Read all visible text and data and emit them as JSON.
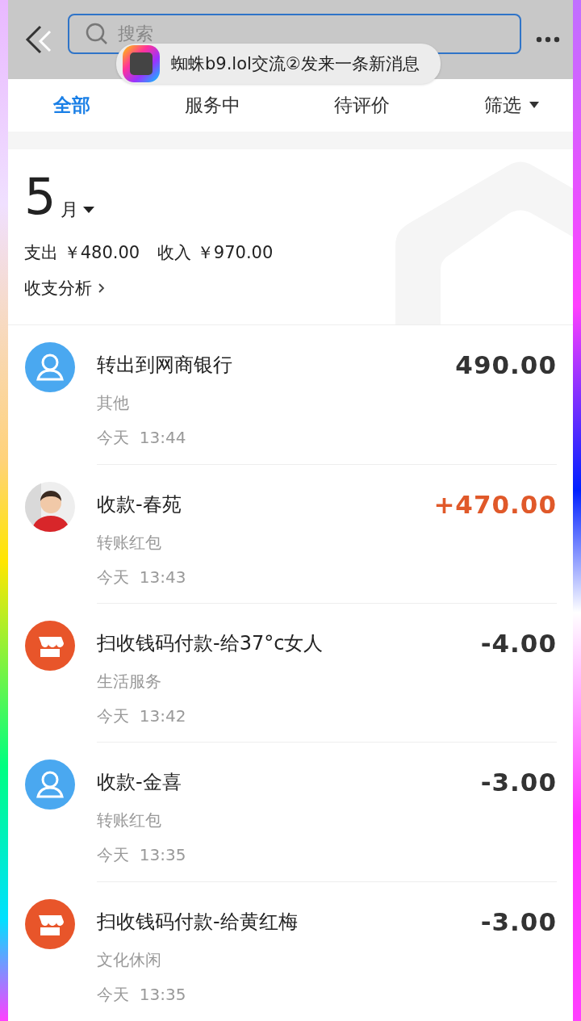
{
  "toast": {
    "text": "蜘蛛b9.lol交流②发来一条新消息"
  },
  "search": {
    "placeholder": "搜索"
  },
  "tabs": [
    {
      "label": "全部",
      "selected": true,
      "kind": "tab"
    },
    {
      "label": "服务中",
      "selected": false,
      "kind": "tab"
    },
    {
      "label": "待评价",
      "selected": false,
      "kind": "tab"
    },
    {
      "label": "筛选",
      "selected": false,
      "kind": "filter"
    }
  ],
  "summary": {
    "month": "5",
    "month_unit": "月",
    "expense_label": "支出",
    "expense": "￥480.00",
    "income_label": "收入",
    "income": "￥970.00",
    "analysis": "收支分析"
  },
  "transactions": [
    {
      "kind": "person",
      "title": "转出到网商银行",
      "category": "其他",
      "day": "今天",
      "time": "13:44",
      "amount": "490.00",
      "income": false
    },
    {
      "kind": "avatar",
      "title": "收款-春苑",
      "category": "转账红包",
      "day": "今天",
      "time": "13:43",
      "amount": "+470.00",
      "income": true
    },
    {
      "kind": "shop",
      "title": "扫收钱码付款-给37°c女人",
      "category": "生活服务",
      "day": "今天",
      "time": "13:42",
      "amount": "-4.00",
      "income": false
    },
    {
      "kind": "person",
      "title": "收款-金喜",
      "category": "转账红包",
      "day": "今天",
      "time": "13:35",
      "amount": "-3.00",
      "income": false
    },
    {
      "kind": "shop",
      "title": "扫收钱码付款-给黄红梅",
      "category": "文化休闲",
      "day": "今天",
      "time": "13:35",
      "amount": "-3.00",
      "income": false
    }
  ]
}
